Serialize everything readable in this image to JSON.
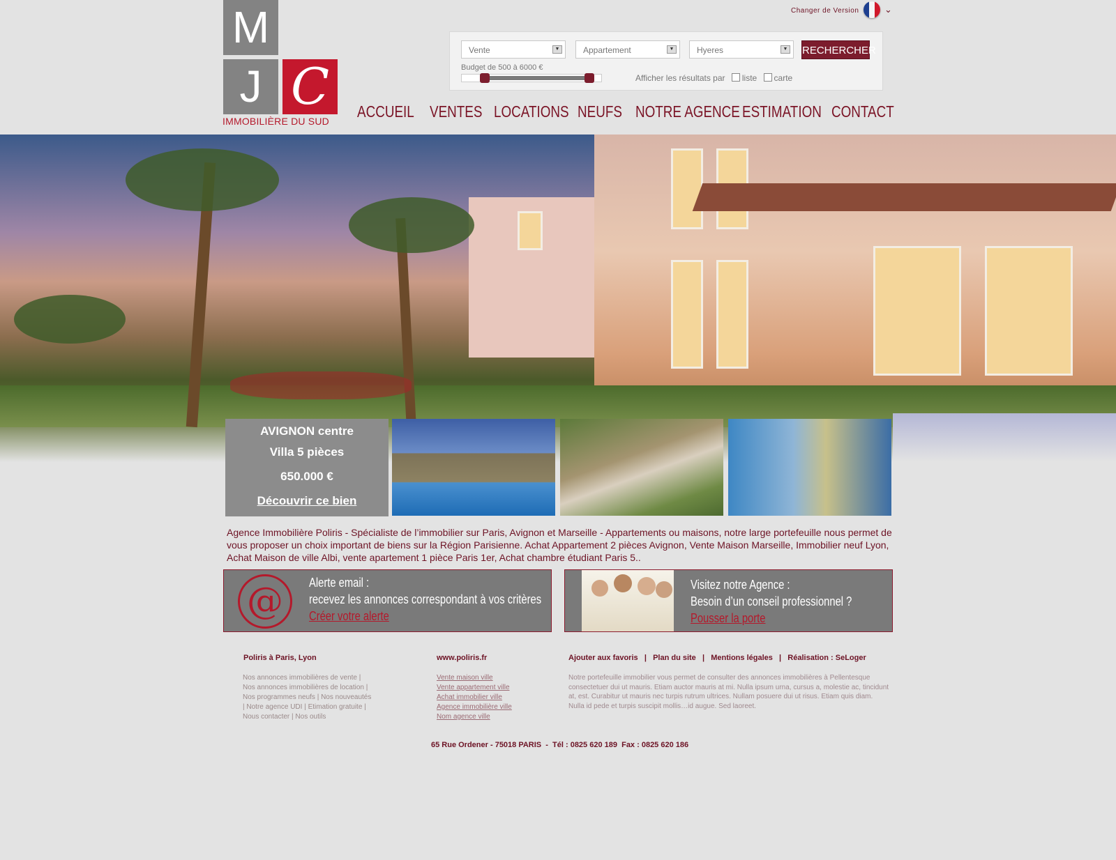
{
  "logo": {
    "letter_m": "M",
    "letter_j": "J",
    "letter_c": "C",
    "subtitle": "IMMOBILIÈRE DU SUD"
  },
  "header": {
    "version_label": "Changer de Version",
    "flag": "france-flag-icon"
  },
  "search": {
    "transaction": "Vente",
    "property_type": "Appartement",
    "city": "Hyeres",
    "button_label": "RECHERCHER",
    "budget_label": "Budget de 500 à 6000 €",
    "budget_min": 500,
    "budget_max": 6000,
    "display_label": "Afficher les résultats par",
    "display_option_list": "liste",
    "display_option_map": "carte"
  },
  "nav": {
    "items": [
      {
        "label": "ACCUEIL"
      },
      {
        "label": "VENTES"
      },
      {
        "label": "LOCATIONS"
      },
      {
        "label": "NEUFS"
      },
      {
        "label": "NOTRE AGENCE"
      },
      {
        "label": "ESTIMATION"
      },
      {
        "label": "CONTACT"
      }
    ]
  },
  "featured": {
    "location": "AVIGNON centre",
    "type": "Villa 5 pièces",
    "price": "650.000 €",
    "link": "Découvrir ce bien"
  },
  "description": "Agence Immobilière Poliris - Spécialiste de l’immobilier sur Paris, Avignon et Marseille - Appartements ou maisons, notre large portefeuille nous permet de vous proposer un choix important de biens sur la Région Parisienne. Achat Appartement 2 pièces Avignon, Vente Maison Marseille, Immobilier neuf Lyon, Achat Maison de ville Albi, vente apartement 1 pièce Paris 1er, Achat chambre étudiant Paris 5..",
  "promo_alert": {
    "title": "Alerte email :",
    "text": "recevez les annonces correspondant à vos critères",
    "link": "Créer votre alerte"
  },
  "promo_agency": {
    "title": "Visitez notre Agence :",
    "text": "Besoin d’un conseil professionnel ?",
    "link": "Pousser la porte"
  },
  "footer": {
    "col1_title": "Poliris à Paris, Lyon",
    "col1_links": [
      "Nos annonces immobilières de vente |",
      "Nos annonces immobilières de location |",
      "Nos programmes neufs | Nos nouveautés",
      "| Notre agence UDI | Etimation gratuite |",
      "Nous contacter | Nos outils"
    ],
    "col2_title": "www.poliris.fr",
    "col2_links": [
      "Vente maison ville",
      "Vente appartement ville",
      "Achat immobilier ville",
      "Agence immobilière ville",
      "Nom agence ville"
    ],
    "col3_links": {
      "favorites": "Ajouter aux favoris",
      "sitemap": "Plan du site",
      "legal": "Mentions légales",
      "credit": "Réalisation : SeLoger",
      "separator": "|"
    },
    "col3_text": "Notre portefeuille immobilier vous permet de consulter des annonces immobilières à Pellentesque consectetuer dui ut mauris. Etiam auctor mauris at mi. Nulla ipsum urna, cursus a, molestie ac, tincidunt at, est. Curabitur ut mauris nec turpis rutrum ultrices. Nullam posuere dui ut risus. Etiam quis diam. Nulla id pede et turpis suscipit mollis…id augue. Sed laoreet.",
    "address": "65 Rue Ordener - 75018 PARIS  -  Tél : 0825 620 189  Fax : 0825 620 186"
  },
  "colors": {
    "brand_red": "#b4192b",
    "dark_red": "#7c1d2d",
    "grey": "#838383",
    "background": "#e3e3e3"
  }
}
